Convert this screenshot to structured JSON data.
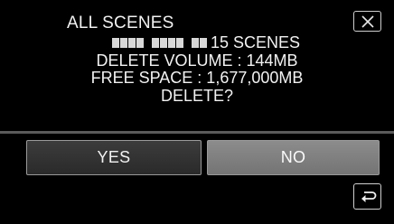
{
  "dialog": {
    "title": "ALL SCENES",
    "scene_count": "15 SCENES",
    "delete_volume": "DELETE VOLUME : 144MB",
    "free_space": "FREE SPACE : 1,677,000MB",
    "question": "DELETE?"
  },
  "buttons": {
    "yes_label": "YES",
    "no_label": "NO"
  },
  "icons": {
    "close": "close-x-icon",
    "back": "return-arrow-icon"
  },
  "colors": {
    "background": "#000000",
    "text": "#f2f2f2",
    "yes_button": "#333333",
    "no_button": "#808080"
  }
}
